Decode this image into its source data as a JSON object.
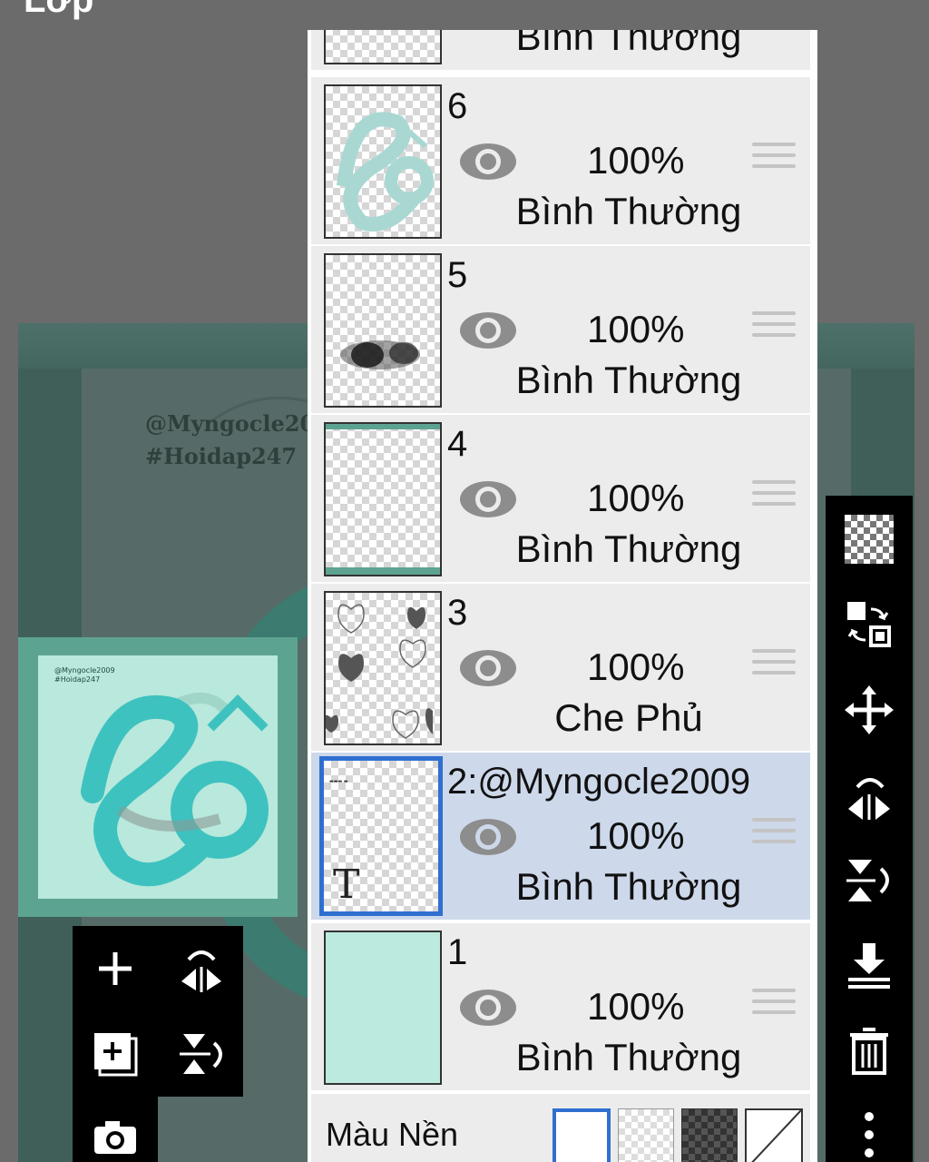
{
  "header": {
    "title": "Lớp"
  },
  "canvas": {
    "watermark_line1": "@Myngocle20",
    "watermark_line2": "#Hoidap247"
  },
  "preview": {
    "line1": "@Myngocle2009",
    "line2": "#Hoidap247"
  },
  "layers": [
    {
      "name": "",
      "opacity": "",
      "blend": "Bình Thường"
    },
    {
      "name": "6",
      "opacity": "100%",
      "blend": "Bình Thường"
    },
    {
      "name": "5",
      "opacity": "100%",
      "blend": "Bình Thường"
    },
    {
      "name": "4",
      "opacity": "100%",
      "blend": "Bình Thường"
    },
    {
      "name": "3",
      "opacity": "100%",
      "blend": "Che Phủ"
    },
    {
      "name": "2:@Myngocle2009",
      "opacity": "100%",
      "blend": "Bình Thường",
      "selected": true,
      "thumb_text": "T"
    },
    {
      "name": "1",
      "opacity": "100%",
      "blend": "Bình Thường"
    }
  ],
  "background_row": {
    "label": "Màu Nền",
    "options": [
      "white",
      "transparent",
      "dark-checker",
      "none"
    ],
    "selected": "white"
  },
  "colors": {
    "accent": "#2f6fd0",
    "selected_row": "#cdd8ea",
    "row": "#ececec",
    "layer1_fill": "#bdeade"
  },
  "right_toolbar": [
    "checker-icon",
    "transfer-icon",
    "move-icon",
    "flip-horizontal-icon",
    "flip-vertical-icon",
    "merge-down-icon",
    "trash-icon",
    "more-icon"
  ],
  "left_toolbar": [
    "add-layer-icon",
    "flip-horizontal-icon",
    "add-folder-icon",
    "flip-vertical-icon",
    "camera-icon"
  ]
}
